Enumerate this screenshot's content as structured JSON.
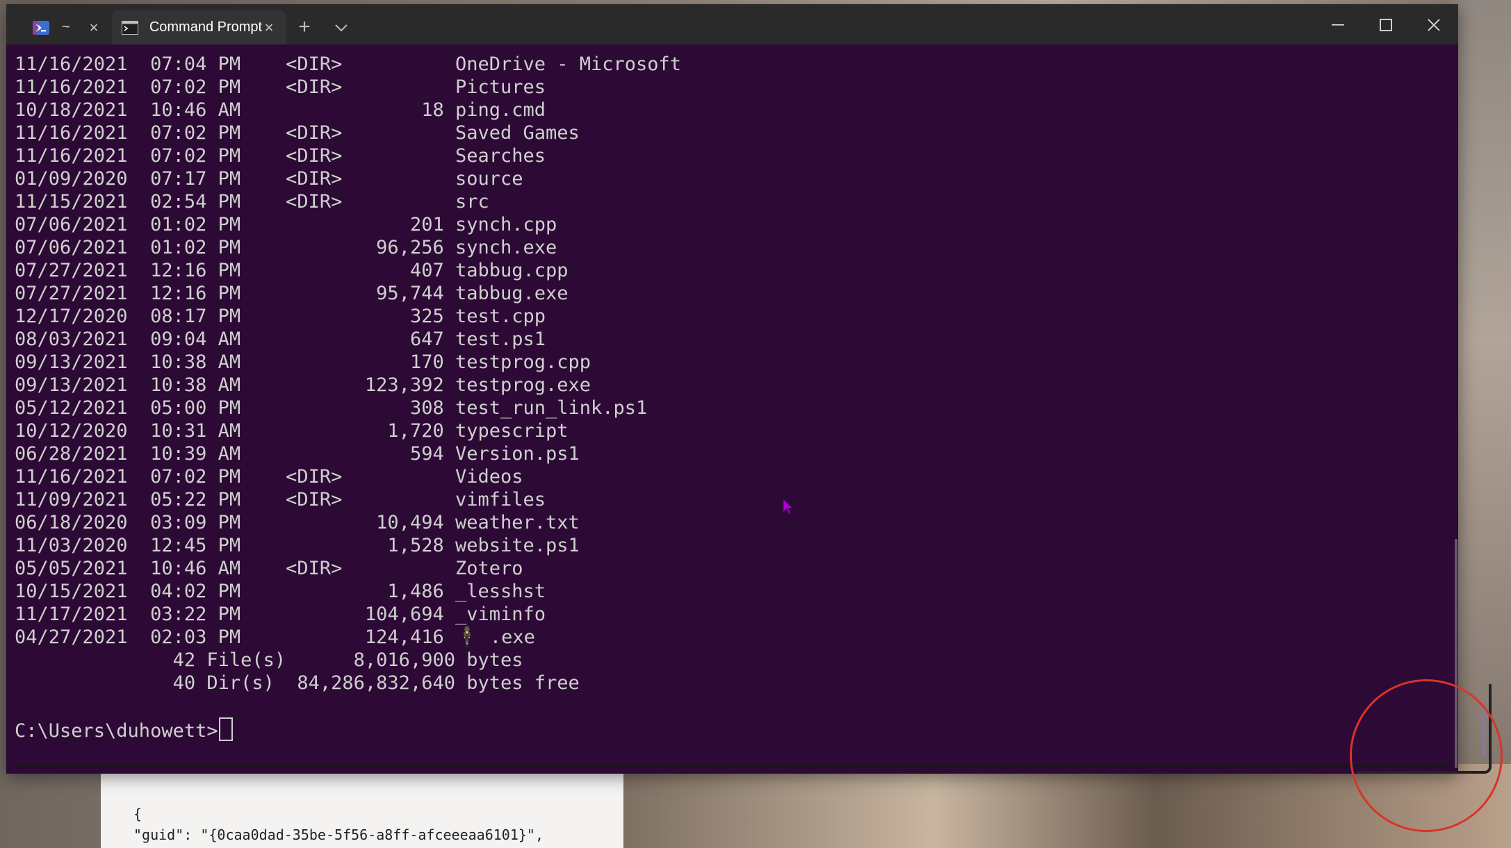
{
  "window": {
    "tabs": [
      {
        "label": "~",
        "icon": "powershell-icon",
        "active": false
      },
      {
        "label": "Command Prompt",
        "icon": "cmd-icon",
        "active": true
      }
    ],
    "new_tab_symbol": "+",
    "close_symbol": "×"
  },
  "terminal": {
    "lines": [
      "11/16/2021  07:04 PM    <DIR>          OneDrive - Microsoft",
      "11/16/2021  07:02 PM    <DIR>          Pictures",
      "10/18/2021  10:46 AM                18 ping.cmd",
      "11/16/2021  07:02 PM    <DIR>          Saved Games",
      "11/16/2021  07:02 PM    <DIR>          Searches",
      "01/09/2020  07:17 PM    <DIR>          source",
      "11/15/2021  02:54 PM    <DIR>          src",
      "07/06/2021  01:02 PM               201 synch.cpp",
      "07/06/2021  01:02 PM            96,256 synch.exe",
      "07/27/2021  12:16 PM               407 tabbug.cpp",
      "07/27/2021  12:16 PM            95,744 tabbug.exe",
      "12/17/2020  08:17 PM               325 test.cpp",
      "08/03/2021  09:04 AM               647 test.ps1",
      "09/13/2021  10:38 AM               170 testprog.cpp",
      "09/13/2021  10:38 AM           123,392 testprog.exe",
      "05/12/2021  05:00 PM               308 test_run_link.ps1",
      "10/12/2020  10:31 AM             1,720 typescript",
      "06/28/2021  10:39 AM               594 Version.ps1",
      "11/16/2021  07:02 PM    <DIR>          Videos",
      "11/09/2021  05:22 PM    <DIR>          vimfiles",
      "06/18/2020  03:09 PM            10,494 weather.txt",
      "11/03/2020  12:45 PM             1,528 website.ps1",
      "05/05/2021  10:46 AM    <DIR>          Zotero",
      "10/15/2021  04:02 PM             1,486 _lesshst",
      "11/17/2021  03:22 PM           104,694 _viminfo",
      "04/27/2021  02:03 PM           124,416 🕴 .exe",
      "              42 File(s)      8,016,900 bytes",
      "              40 Dir(s)  84,286,832,640 bytes free"
    ],
    "prompt": "C:\\Users\\duhowett>"
  },
  "background_editor": {
    "lines": [
      "{",
      "\"guid\": \"{0caa0dad-35be-5f56-a8ff-afceeeaa6101}\","
    ]
  },
  "colors": {
    "terminal_bg": "#2c0a35",
    "titlebar_bg": "#2a2a2b",
    "text": "#cfcfcf",
    "annotation": "#d9332b",
    "pointer": "#b000d8"
  }
}
